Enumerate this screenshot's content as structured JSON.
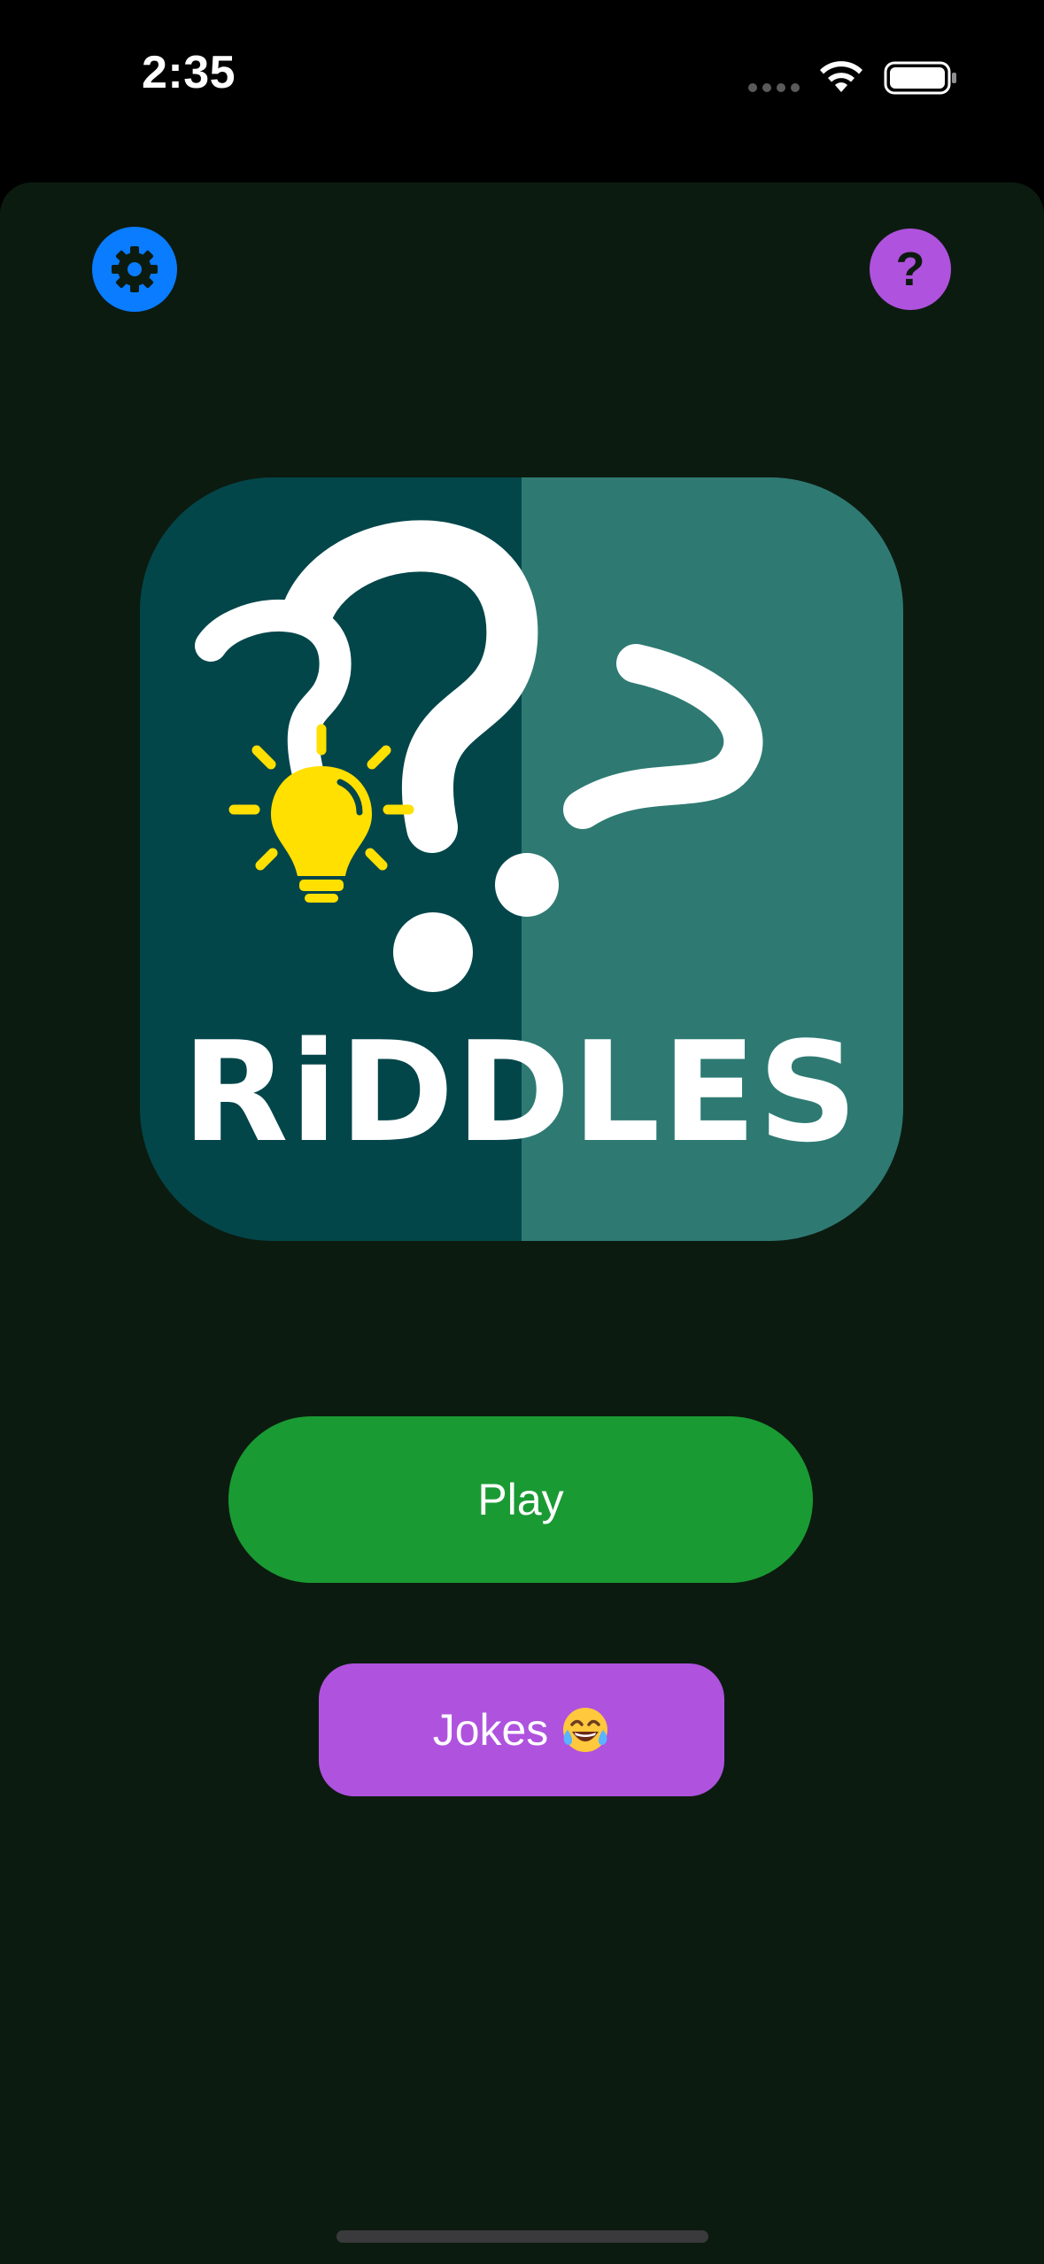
{
  "status_bar": {
    "time": "2:35",
    "icons": [
      "signal-dots-icon",
      "wifi-icon",
      "battery-icon"
    ]
  },
  "header": {
    "settings_icon": "gear-icon",
    "help_label": "?"
  },
  "logo": {
    "text": "RiDDLES",
    "icons": [
      "question-mark-icon",
      "lightbulb-icon"
    ],
    "colors": {
      "left_panel": "#03464a",
      "right_panel": "#2e7a73",
      "bulb": "#ffe000",
      "glyphs": "#ffffff"
    }
  },
  "actions": {
    "play_label": "Play",
    "jokes_label": "Jokes",
    "jokes_emoji": "😂"
  },
  "colors": {
    "background": "#0c1b10",
    "settings_accent": "#0a7cff",
    "help_accent": "#af52de",
    "play_accent": "#1a9a33",
    "jokes_accent": "#af52de"
  }
}
